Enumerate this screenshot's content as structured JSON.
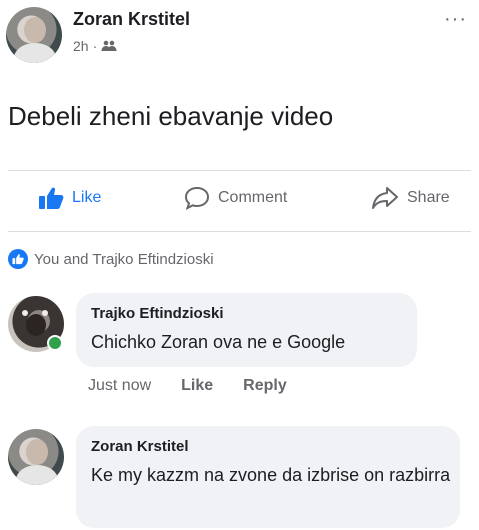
{
  "post": {
    "author": "Zoran Krstitel",
    "time": "2h",
    "separator": "·",
    "audience_icon": "friends-icon",
    "text": "Debeli zheni ebavanje video",
    "more_label": "···"
  },
  "actions": {
    "like": "Like",
    "comment": "Comment",
    "share": "Share"
  },
  "reactions": {
    "text": "You and Trajko Eftindzioski"
  },
  "comments": [
    {
      "author": "Trajko Eftindzioski",
      "text": "Chichko Zoran ova ne e Google",
      "time": "Just now",
      "like_label": "Like",
      "reply_label": "Reply",
      "online": true
    },
    {
      "author": "Zoran Krstitel",
      "text": "Ke my kazzm na zvone da izbrise on razbirra"
    }
  ],
  "colors": {
    "accent": "#1877f2",
    "secondary_text": "#65676b",
    "bubble": "#f0f2f5",
    "online": "#31a24c"
  }
}
